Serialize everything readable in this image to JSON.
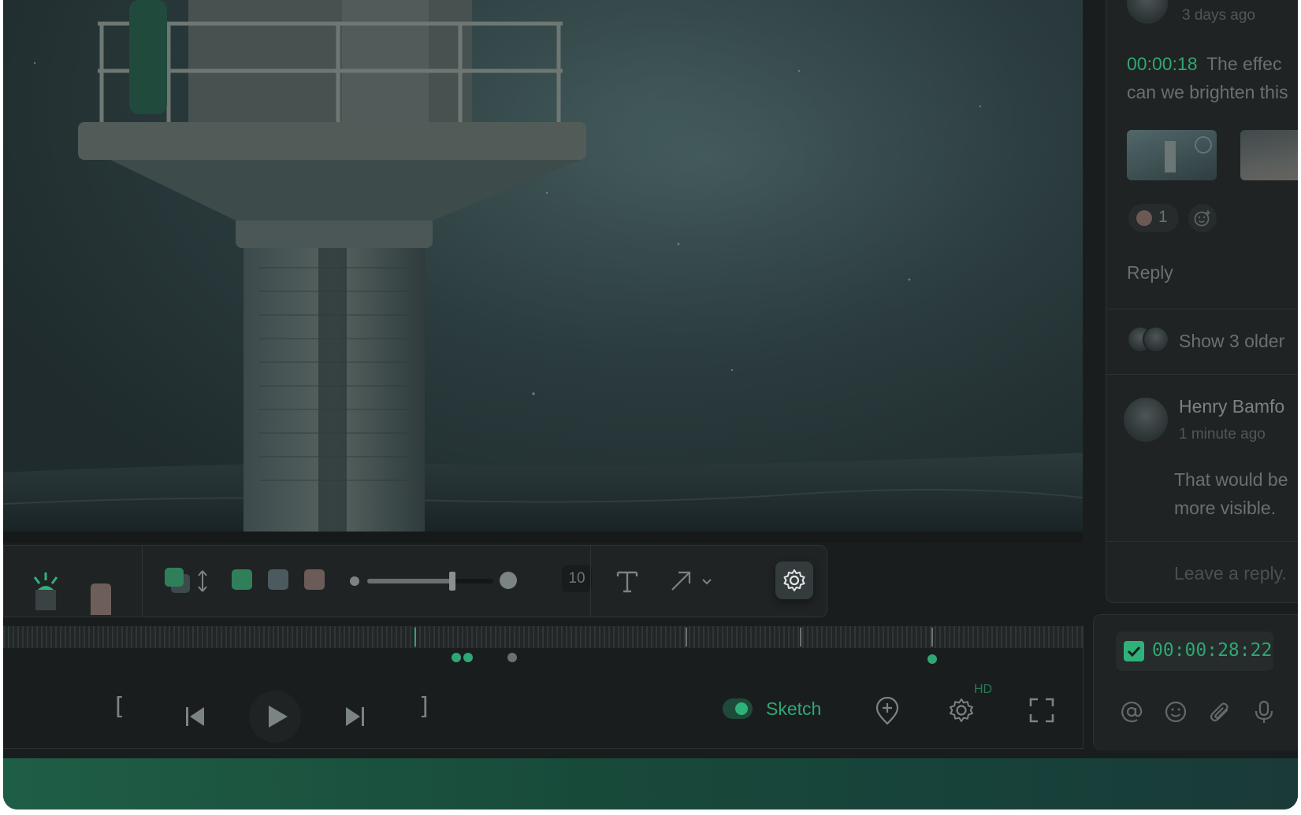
{
  "colors": {
    "accent": "#2fb27a",
    "background": "#1a1d1e",
    "panel": "#1f2324",
    "muted_text": "#687071"
  },
  "video": {
    "scene": "lighthouse-in-storm"
  },
  "toolbar": {
    "swatches": [
      "#2f7f5a",
      "#4b5a5e",
      "#6c5b58"
    ],
    "brush_size": "10",
    "text_tool_label": "T",
    "icons": [
      "layers-icon",
      "swap-vertical-icon",
      "text-tool-icon",
      "arrow-tool-icon",
      "chevron-down-icon",
      "settings-gear-icon"
    ]
  },
  "timeline": {
    "markers": [
      "green",
      "gray",
      "gray",
      "gray"
    ],
    "dots": [
      "green",
      "green",
      "gray",
      "green"
    ]
  },
  "player": {
    "in_point": "[",
    "out_point": "]",
    "sketch_label": "Sketch",
    "sketch_enabled": true,
    "quality_badge": "HD"
  },
  "comments": {
    "first": {
      "time_ago": "3 days ago",
      "timecode": "00:00:18",
      "text_line1": "The effec",
      "text_line2": "can we brighten this",
      "reaction_count": "1",
      "reply_label": "Reply"
    },
    "show_older_label": "Show 3 older",
    "second": {
      "author": "Henry Bamfo",
      "time_ago": "1 minute ago",
      "text_line1": "That would be",
      "text_line2": "more visible."
    },
    "reply_placeholder": "Leave a reply."
  },
  "composer": {
    "timecode": "00:00:28:22",
    "timecode_checked": true,
    "icons": [
      "mention-icon",
      "emoji-icon",
      "attachment-icon",
      "microphone-icon"
    ]
  }
}
